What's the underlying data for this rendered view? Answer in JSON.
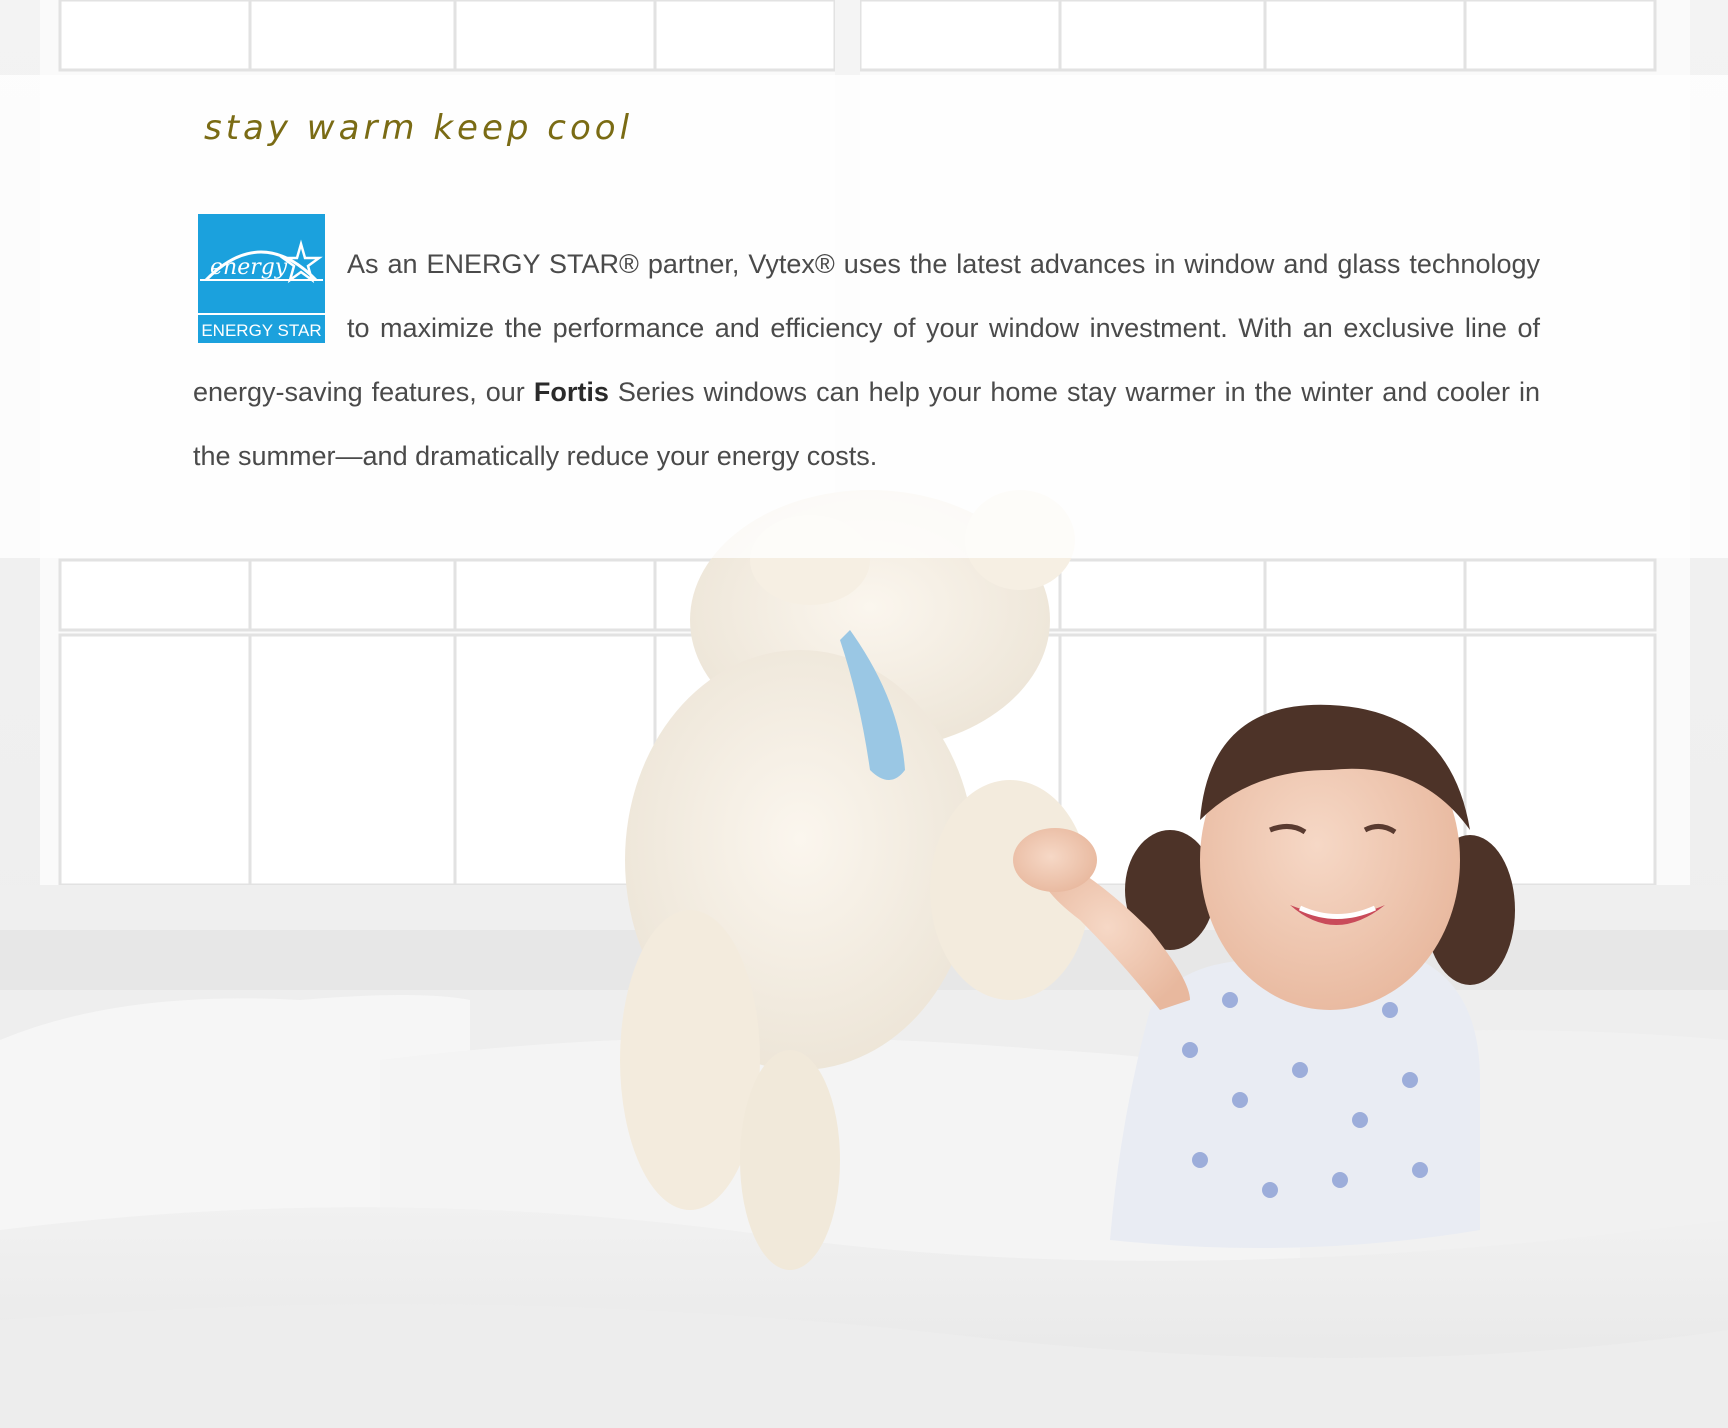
{
  "headline": "stay warm keep cool",
  "logo": {
    "script_text": "energy",
    "label": "ENERGY STAR",
    "color": "#1ba1dd"
  },
  "body": {
    "part1": "As an ENERGY STAR® partner, Vytex® uses the latest advances in window and glass technology to maximize the performance and efficiency of your window investment. With an exclusive line of energy-saving features, our ",
    "brand": "Fortis",
    "part2": " Series windows can help your home stay warmer in the winter and cooler in the summer—and dramatically reduce your energy costs."
  },
  "photo": {
    "subject": "child-with-teddy-bear",
    "accent_color": "#7a6b14"
  }
}
